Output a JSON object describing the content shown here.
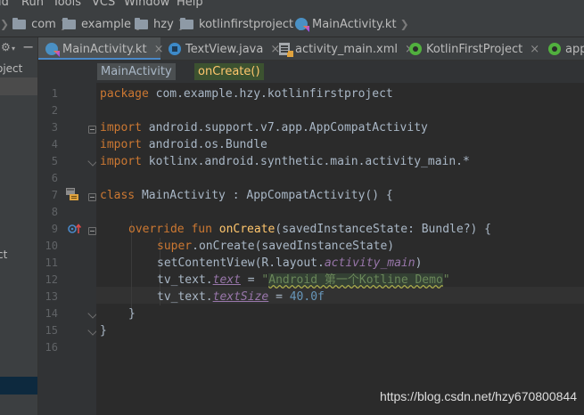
{
  "menu": [
    "ld",
    "Run",
    "Tools",
    "VCS",
    "Window",
    "Help"
  ],
  "breadcrumb": [
    "com",
    "example",
    "hzy",
    "kotlinfirstproject",
    "MainActivity.kt"
  ],
  "project_panel": {
    "header_fragment": "oject",
    "item_fragment": "ct"
  },
  "tabs": [
    {
      "label": "MainActivity.kt",
      "icon": "kotlin-file-icon",
      "active": true,
      "closable": true
    },
    {
      "label": "TextView.java",
      "icon": "java-class-icon",
      "active": false,
      "closable": true
    },
    {
      "label": "activity_main.xml",
      "icon": "xml-layout-icon",
      "active": false,
      "closable": true
    },
    {
      "label": "KotlinFirstProject",
      "icon": "kotlin-project-icon",
      "active": false,
      "closable": true
    },
    {
      "label": "app",
      "icon": "kotlin-project-icon",
      "active": false,
      "closable": false
    }
  ],
  "structure": {
    "class_name": "MainActivity",
    "function_name": "onCreate()"
  },
  "code": {
    "line_numbers": [
      "1",
      "2",
      "3",
      "4",
      "5",
      "6",
      "7",
      "8",
      "9",
      "10",
      "11",
      "12",
      "13",
      "14",
      "15",
      "16"
    ],
    "l1": {
      "kw": "package",
      "rest": " com.example.hzy.kotlinfirstproject"
    },
    "l3": {
      "kw": "import",
      "rest": " android.support.v7.app.AppCompatActivity"
    },
    "l4": {
      "kw": "import",
      "rest": " android.os.Bundle"
    },
    "l5": {
      "kw": "import",
      "rest": " kotlinx.android.synthetic.main.activity_main.*"
    },
    "l7": {
      "kw": "class",
      "rest": " MainActivity : AppCompatActivity() {"
    },
    "l9": {
      "kw": "override fun",
      "fn": "onCreate",
      "rest": "(savedInstanceState: Bundle?) {"
    },
    "l10": {
      "kw": "super",
      "rest": ".onCreate(savedInstanceState)"
    },
    "l11": {
      "pre": "setContentView(R.layout.",
      "prop": "activity_main",
      "post": ")"
    },
    "l12": {
      "pre": "tv_text.",
      "prop": "text",
      "mid": " = ",
      "str_q1": "\"",
      "str_body": "Android 第一个Kotline Demo",
      "str_q2": "\""
    },
    "l13": {
      "pre": "tv_text.",
      "prop": "textSize",
      "mid": " = ",
      "num": "40.0f"
    },
    "l14": "}",
    "l15": "}"
  },
  "colors": {
    "keyword": "#cc7832",
    "function": "#ffc66d",
    "property": "#9876aa",
    "number": "#6897bb",
    "string": "#6a8759",
    "text": "#a9b7c6",
    "background": "#2b2b2b"
  },
  "watermark": "https://blog.csdn.net/hzy670800844"
}
